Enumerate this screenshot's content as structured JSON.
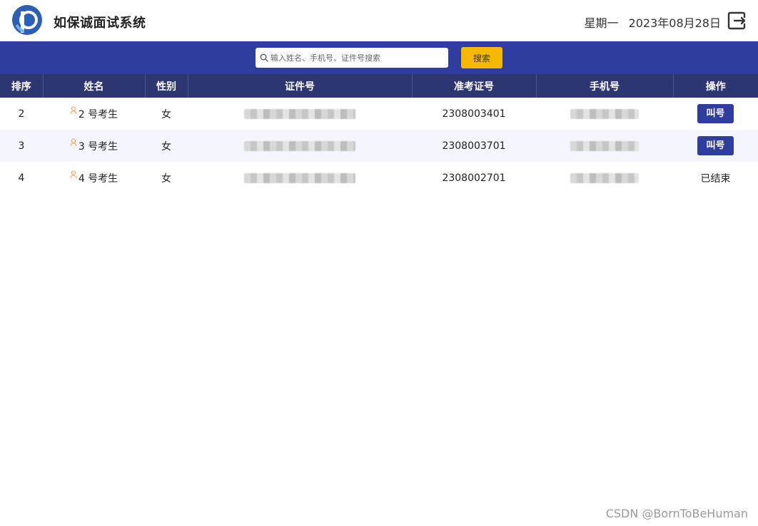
{
  "header": {
    "title": "如保诚面试系统",
    "weekday": "星期一",
    "date": "2023年08月28日"
  },
  "search": {
    "placeholder": "输入姓名、手机号、证件号搜索",
    "button_label": "搜索"
  },
  "table": {
    "columns": [
      "排序",
      "姓名",
      "性别",
      "证件号",
      "准考证号",
      "手机号",
      "操作"
    ],
    "rows": [
      {
        "order": "2",
        "name": "2 号考生",
        "gender": "女",
        "exam_no": "2308003401",
        "action": "叫号",
        "action_type": "button"
      },
      {
        "order": "3",
        "name": "3 号考生",
        "gender": "女",
        "exam_no": "2308003701",
        "action": "叫号",
        "action_type": "button"
      },
      {
        "order": "4",
        "name": "4 号考生",
        "gender": "女",
        "exam_no": "2308002701",
        "action": "已结束",
        "action_type": "text"
      }
    ]
  },
  "watermark": "CSDN @BornToBeHuman",
  "icons": {
    "logo": "logo-icon",
    "logout": "logout-icon",
    "search": "search-icon",
    "user": "user-icon"
  },
  "colors": {
    "brand": "#2f3e9e",
    "table_header": "#2d3670",
    "search_button": "#f6b800",
    "user_icon": "#f0a85a"
  }
}
